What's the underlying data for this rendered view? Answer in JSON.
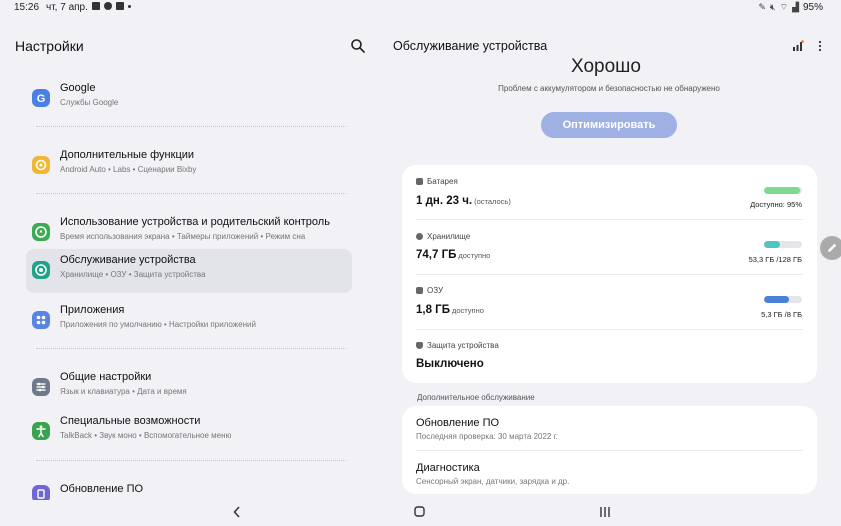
{
  "status_bar": {
    "time": "15:26",
    "date": "чт, 7 апр.",
    "battery": "95%"
  },
  "left": {
    "title": "Настройки",
    "items": [
      {
        "title": "Google",
        "subtitle": "Службы Google",
        "icon": "google-icon",
        "color": "#4a7fe6"
      },
      {
        "title": "Дополнительные функции",
        "subtitle": "Android Auto  •  Labs  •  Сценарии Bixby",
        "icon": "plus-gear-icon",
        "color": "#f2b632"
      },
      {
        "title": "Использование устройства и родительский контроль",
        "subtitle": "Время использования экрана  •  Таймеры приложений  •  Режим сна",
        "icon": "wellbeing-icon",
        "color": "#3eaa56"
      },
      {
        "title": "Обслуживание устройства",
        "subtitle": "Хранилище  •  ОЗУ  •  Защита устройства",
        "icon": "device-care-icon",
        "color": "#1fa38a"
      },
      {
        "title": "Приложения",
        "subtitle": "Приложения по умолчанию  •  Настройки приложений",
        "icon": "apps-icon",
        "color": "#5a84e8"
      },
      {
        "title": "Общие настройки",
        "subtitle": "Язык и клавиатура  •  Дата и время",
        "icon": "sliders-icon",
        "color": "#6e7a8c"
      },
      {
        "title": "Специальные возможности",
        "subtitle": "TalkBack  •  Звук моно  •  Вспомогательное меню",
        "icon": "accessibility-icon",
        "color": "#39a44d"
      },
      {
        "title": "Обновление ПО",
        "subtitle": "",
        "icon": "update-icon",
        "color": "#7066d6"
      }
    ]
  },
  "right": {
    "title": "Обслуживание устройства",
    "status": "Хорошо",
    "note": "Проблем с аккумулятором и безопасностью не обнаружено",
    "optimize": "Оптимизировать",
    "battery": {
      "label": "Батарея",
      "value": "1 дн. 23 ч.",
      "suffix": "(осталось)",
      "right": "Доступно: 95%",
      "level": 0.95,
      "color": "#7ed88d"
    },
    "storage": {
      "label": "Хранилище",
      "value": "74,7 ГБ",
      "suffix": "доступно",
      "right": "53,3 ГБ /128 ГБ",
      "level": 0.42,
      "color": "#4ec4c4"
    },
    "ram": {
      "label": "ОЗУ",
      "value": "1,8 ГБ",
      "suffix": "доступно",
      "right": "5,3 ГБ /8 ГБ",
      "level": 0.66,
      "color": "#4a80d6"
    },
    "security": {
      "label": "Защита устройства",
      "value": "Выключено"
    },
    "section": "Дополнительное обслуживание",
    "update": {
      "title": "Обновление ПО",
      "subtitle": "Последняя проверка: 30 марта 2022 г."
    },
    "diagnostics": {
      "title": "Диагностика",
      "subtitle": "Сенсорный экран, датчики, зарядка и др."
    }
  }
}
